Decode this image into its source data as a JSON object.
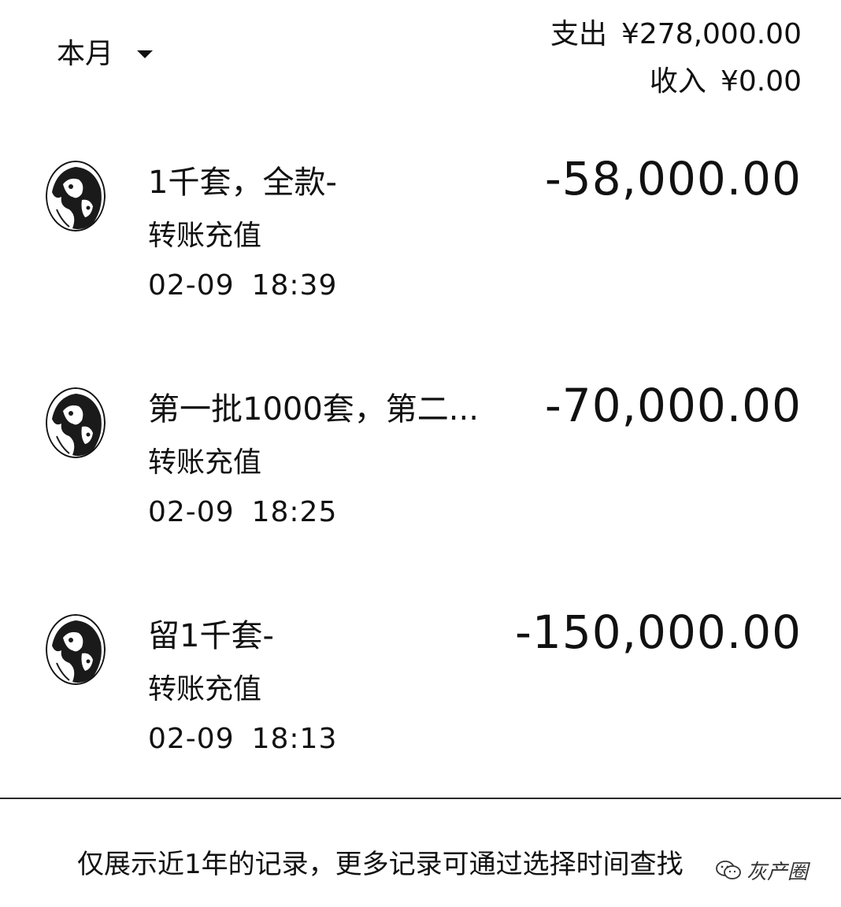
{
  "header": {
    "period_label": "本月",
    "expense_label": "支出",
    "expense_value": "¥278,000.00",
    "income_label": "收入",
    "income_value": "¥0.00"
  },
  "transactions": [
    {
      "title": "1千套，全款-",
      "amount": "-58,000.00",
      "type": "转账充值",
      "date": "02-09",
      "time": "18:39"
    },
    {
      "title": "第一批1000套，第二...",
      "amount": "-70,000.00",
      "type": "转账充值",
      "date": "02-09",
      "time": "18:25"
    },
    {
      "title": "留1千套-",
      "amount": "-150,000.00",
      "type": "转账充值",
      "date": "02-09",
      "time": "18:13"
    }
  ],
  "footer": {
    "note": "仅展示近1年的记录，更多记录可通过选择时间查找"
  },
  "watermark": {
    "text": "灰产圈",
    "icon": "wechat-icon"
  },
  "colors": {
    "text": "#111111",
    "background": "#ffffff",
    "divider": "#2a2a2a"
  }
}
